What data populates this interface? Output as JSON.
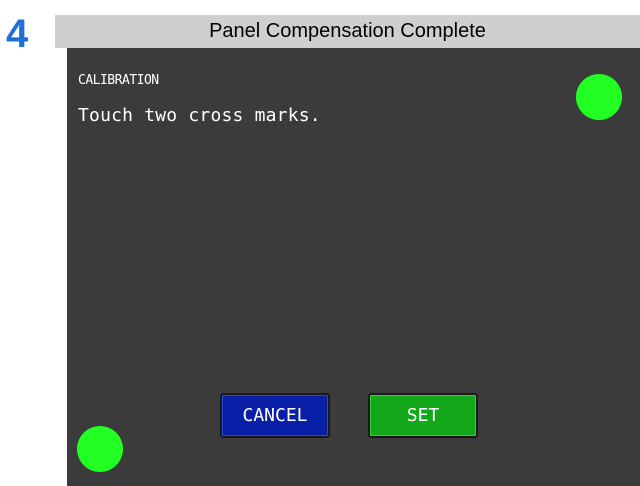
{
  "step": {
    "number": "4",
    "color": "#1f6fd6"
  },
  "header": {
    "title": "Panel Compensation Complete"
  },
  "screen": {
    "heading": "CALIBRATION",
    "instruction": "Touch two cross marks.",
    "background_color": "#3b3b3b",
    "cross_marks": [
      {
        "icon": "green-dot-icon",
        "color": "#22ff22",
        "position": "top-right"
      },
      {
        "icon": "green-dot-icon",
        "color": "#22ff22",
        "position": "bottom-left"
      }
    ]
  },
  "buttons": {
    "cancel_label": "CANCEL",
    "cancel_color": "#0a1fa8",
    "set_label": "SET",
    "set_color": "#12a81a"
  }
}
